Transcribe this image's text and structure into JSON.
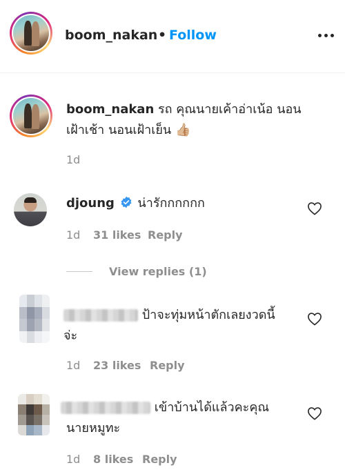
{
  "header": {
    "username": "boom_nakan",
    "separator": "•",
    "follow_label": "Follow",
    "more_icon": "more-options-icon"
  },
  "caption": {
    "username": "boom_nakan",
    "text_line1": "รถ คุณนายเค้าอ่าเน้อ นอน",
    "text_line2": "เฝ้าเช้า นอนเฝ้าเย็น",
    "emoji": "👍🏼",
    "time": "1d"
  },
  "comments": [
    {
      "username": "djoung",
      "verified": true,
      "text": "น่ารักกกกกก",
      "time": "1d",
      "likes": "31 likes",
      "reply_label": "Reply",
      "view_replies": "View replies (1)"
    },
    {
      "username_hidden": true,
      "text_line1": "ป้าจะทุ่มหน้าตักเลยงวดนี้",
      "text_line2": "จ่ะ",
      "time": "1d",
      "likes": "23 likes",
      "reply_label": "Reply"
    },
    {
      "username_hidden": true,
      "text_line1": "เข้าบ้านได้แล้วคะคุณ",
      "text_line2": "นายหมูทะ",
      "time": "1d",
      "likes": "8 likes",
      "reply_label": "Reply"
    }
  ],
  "colors": {
    "follow": "#0095f6",
    "secondary_text": "#8e8e8e",
    "verified_badge": "#3897f0"
  }
}
